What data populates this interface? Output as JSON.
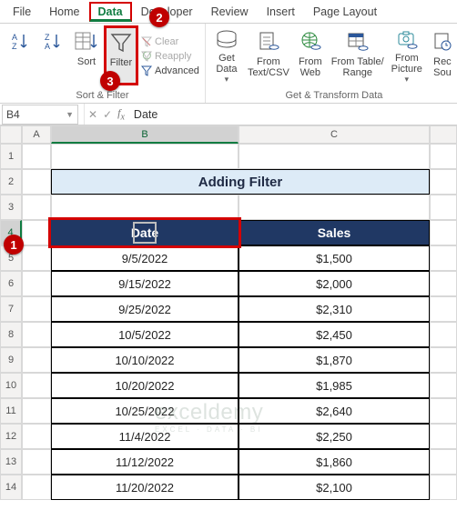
{
  "menu": {
    "tabs": [
      "File",
      "Home",
      "Data",
      "Developer",
      "Review",
      "Insert",
      "Page Layout"
    ],
    "active_index": 2
  },
  "ribbon": {
    "group_sortfilter": {
      "label": "Sort & Filter",
      "sort_az": "A→Z",
      "sort_za": "Z→A",
      "sort": "Sort",
      "filter": "Filter",
      "clear": "Clear",
      "reapply": "Reapply",
      "advanced": "Advanced"
    },
    "group_getdata": {
      "label": "Get & Transform Data",
      "get_data": "Get\nData",
      "from_csv": "From\nText/CSV",
      "from_web": "From\nWeb",
      "from_table": "From Table/\nRange",
      "from_pic": "From\nPicture",
      "recent": "Rec\nSou"
    }
  },
  "fx": {
    "cell_ref": "B4",
    "formula": "Date"
  },
  "columns": [
    "A",
    "B",
    "C"
  ],
  "table": {
    "title": "Adding Filter",
    "headers": {
      "date": "Date",
      "sales": "Sales"
    },
    "rows": [
      {
        "date": "9/5/2022",
        "sales": "$1,500"
      },
      {
        "date": "9/15/2022",
        "sales": "$2,000"
      },
      {
        "date": "9/25/2022",
        "sales": "$2,310"
      },
      {
        "date": "10/5/2022",
        "sales": "$2,450"
      },
      {
        "date": "10/10/2022",
        "sales": "$1,870"
      },
      {
        "date": "10/20/2022",
        "sales": "$1,985"
      },
      {
        "date": "10/25/2022",
        "sales": "$2,640"
      },
      {
        "date": "11/4/2022",
        "sales": "$2,250"
      },
      {
        "date": "11/12/2022",
        "sales": "$1,860"
      },
      {
        "date": "11/20/2022",
        "sales": "$2,100"
      }
    ]
  },
  "callouts": {
    "c1": "1",
    "c2": "2",
    "c3": "3"
  },
  "watermark": {
    "brand": "exceldemy",
    "tag": "EXCEL · DATA · BI"
  }
}
